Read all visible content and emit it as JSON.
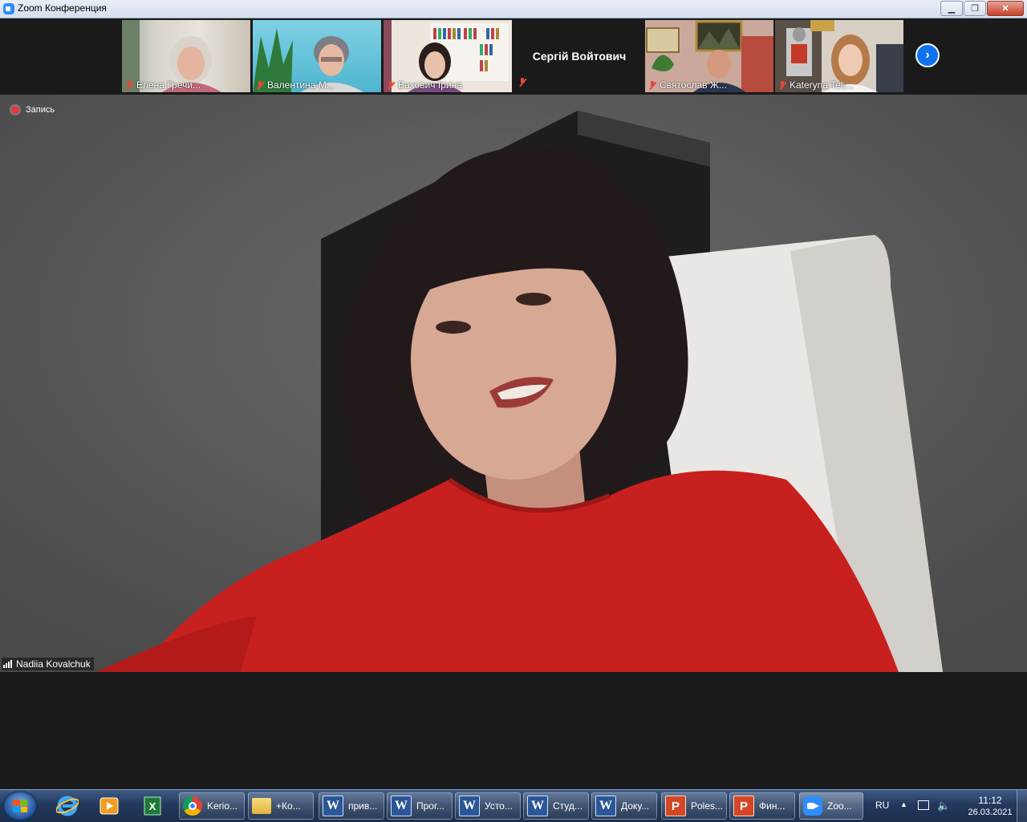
{
  "window": {
    "title": "Zoom Конференция"
  },
  "participants": [
    {
      "name": "Елена Гречи...",
      "muted": true
    },
    {
      "name": "Валентина М...",
      "muted": true
    },
    {
      "name": "Вахович Ірина",
      "muted": true
    },
    {
      "name": "Сергій Войтович",
      "muted": true,
      "video_off": true
    },
    {
      "name": "Святослав Ж...",
      "muted": true
    },
    {
      "name": "Kateryna Teli...",
      "muted": true
    }
  ],
  "recording": {
    "label": "Запись"
  },
  "speaker": {
    "name": "Nadiia Kovalchuk"
  },
  "taskbar": {
    "buttons": [
      {
        "label": "Kerio...",
        "icon": "chrome-icon"
      },
      {
        "label": "+Ко...",
        "icon": "folder-icon"
      },
      {
        "label": "прив...",
        "icon": "word-icon"
      },
      {
        "label": "Прог...",
        "icon": "word-icon"
      },
      {
        "label": "Усто...",
        "icon": "word-icon"
      },
      {
        "label": "Студ...",
        "icon": "word-icon"
      },
      {
        "label": "Доку...",
        "icon": "word-icon"
      },
      {
        "label": "Poles...",
        "icon": "powerpoint-icon"
      },
      {
        "label": "Фин...",
        "icon": "powerpoint-icon"
      },
      {
        "label": "Zoo...",
        "icon": "zoom-icon"
      }
    ],
    "tray": {
      "language": "RU",
      "time": "11:12",
      "date": "26.03.2021"
    }
  },
  "colors": {
    "zoom_blue": "#2d8cff",
    "recording_red": "#e2393a",
    "muted_red": "#e5483a"
  }
}
